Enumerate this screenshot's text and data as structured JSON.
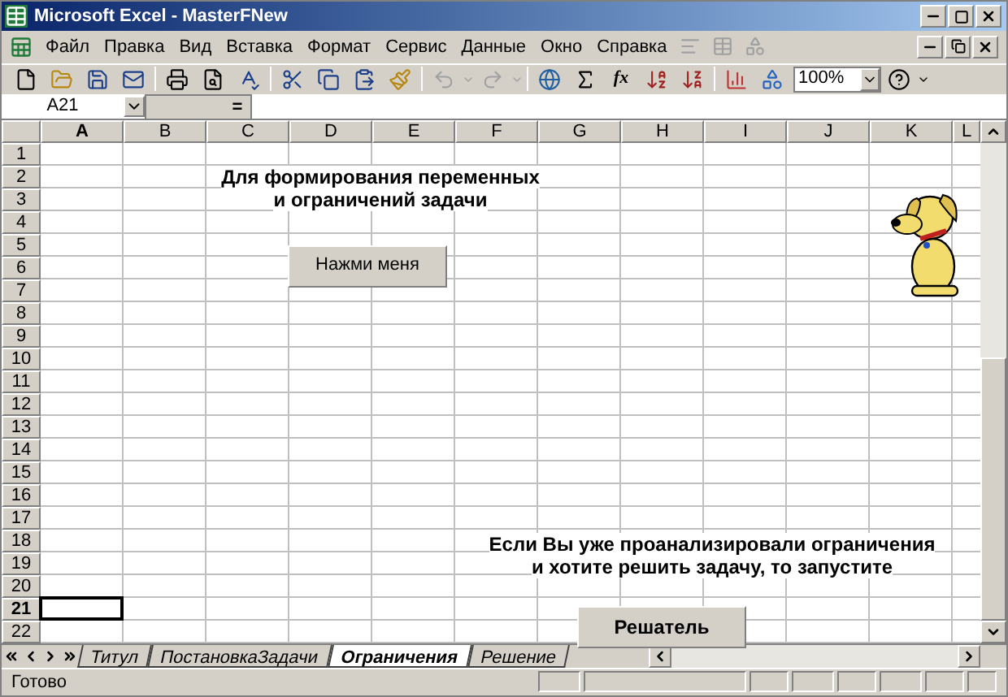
{
  "window": {
    "title": "Microsoft Excel - MasterFNew"
  },
  "menu": [
    "Файл",
    "Правка",
    "Вид",
    "Вставка",
    "Формат",
    "Сервис",
    "Данные",
    "Окно",
    "Справка"
  ],
  "toolbar": {
    "function_label": "fx",
    "zoom": "100%"
  },
  "formula_bar": {
    "name_box": "A21",
    "equals": "="
  },
  "columns": [
    {
      "label": "A",
      "selected": true
    },
    {
      "label": "B",
      "selected": false
    },
    {
      "label": "C",
      "selected": false
    },
    {
      "label": "D",
      "selected": false
    },
    {
      "label": "E",
      "selected": false
    },
    {
      "label": "F",
      "selected": false
    },
    {
      "label": "G",
      "selected": false
    },
    {
      "label": "H",
      "selected": false
    },
    {
      "label": "I",
      "selected": false
    },
    {
      "label": "J",
      "selected": false
    },
    {
      "label": "K",
      "selected": false
    },
    {
      "label": "L",
      "selected": false
    }
  ],
  "rows": [
    {
      "label": "1",
      "selected": false
    },
    {
      "label": "2",
      "selected": false
    },
    {
      "label": "3",
      "selected": false
    },
    {
      "label": "4",
      "selected": false
    },
    {
      "label": "5",
      "selected": false
    },
    {
      "label": "6",
      "selected": false
    },
    {
      "label": "7",
      "selected": false
    },
    {
      "label": "8",
      "selected": false
    },
    {
      "label": "9",
      "selected": false
    },
    {
      "label": "10",
      "selected": false
    },
    {
      "label": "11",
      "selected": false
    },
    {
      "label": "12",
      "selected": false
    },
    {
      "label": "13",
      "selected": false
    },
    {
      "label": "14",
      "selected": false
    },
    {
      "label": "15",
      "selected": false
    },
    {
      "label": "16",
      "selected": false
    },
    {
      "label": "17",
      "selected": false
    },
    {
      "label": "18",
      "selected": false
    },
    {
      "label": "19",
      "selected": false
    },
    {
      "label": "20",
      "selected": false
    },
    {
      "label": "21",
      "selected": true
    },
    {
      "label": "22",
      "selected": false
    }
  ],
  "sheet_objects": {
    "top_note": [
      "Для формирования переменных",
      "и ограничений задачи"
    ],
    "top_button": "Нажми меня",
    "bottom_note": [
      "Если Вы уже проанализировали ограничения",
      "и хотите решить задачу, то запустите"
    ],
    "bottom_button": "Решатель"
  },
  "sheet_tabs": [
    {
      "label": "Титул",
      "selected": false
    },
    {
      "label": "ПостановкаЗадачи",
      "selected": false
    },
    {
      "label": "Ограничения",
      "selected": true
    },
    {
      "label": "Решение",
      "selected": false
    }
  ],
  "status_bar": {
    "text": "Готово"
  }
}
